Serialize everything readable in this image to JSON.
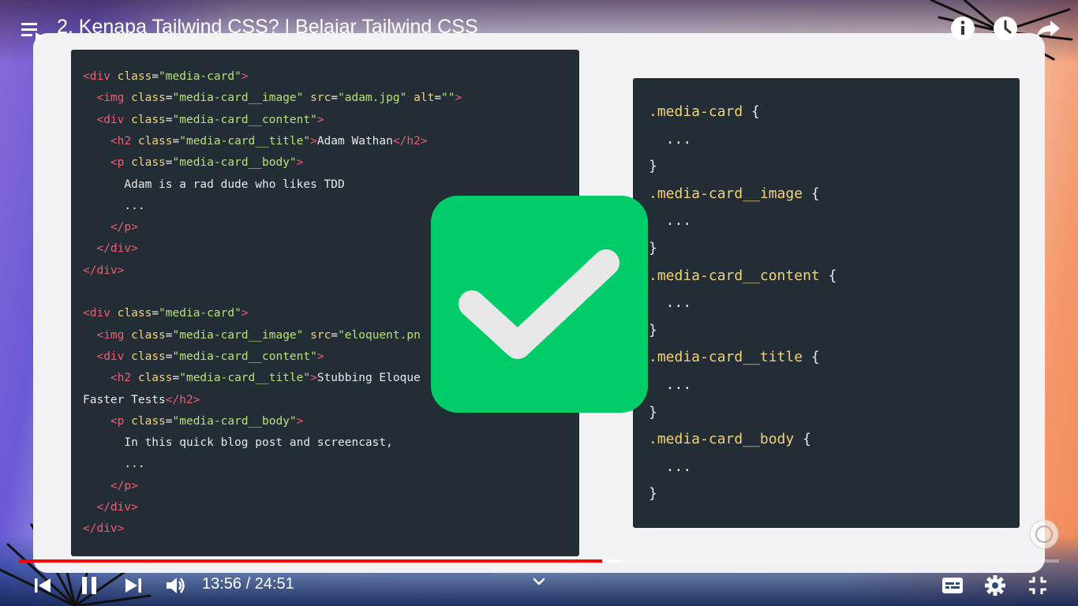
{
  "video": {
    "title": "2. Kenapa Tailwind CSS? | Belajar Tailwind CSS",
    "current_time": "13:56",
    "duration": "24:51",
    "time_display": "13:56 / 24:51",
    "progress": 0.561,
    "buffered": 0.578
  },
  "html_code": [
    [
      [
        "t",
        "<div "
      ],
      [
        "a",
        "class"
      ],
      [
        "p",
        "="
      ],
      [
        "v",
        "\"media-card\""
      ],
      [
        "t",
        ">"
      ]
    ],
    [
      [
        "p",
        "  "
      ],
      [
        "t",
        "<img "
      ],
      [
        "a",
        "class"
      ],
      [
        "p",
        "="
      ],
      [
        "v",
        "\"media-card__image\""
      ],
      [
        "p",
        " "
      ],
      [
        "a",
        "src"
      ],
      [
        "p",
        "="
      ],
      [
        "v",
        "\"adam.jpg\""
      ],
      [
        "p",
        " "
      ],
      [
        "a",
        "alt"
      ],
      [
        "p",
        "="
      ],
      [
        "v",
        "\"\""
      ],
      [
        "t",
        ">"
      ]
    ],
    [
      [
        "p",
        "  "
      ],
      [
        "t",
        "<div "
      ],
      [
        "a",
        "class"
      ],
      [
        "p",
        "="
      ],
      [
        "v",
        "\"media-card__content\""
      ],
      [
        "t",
        ">"
      ]
    ],
    [
      [
        "p",
        "    "
      ],
      [
        "t",
        "<h2 "
      ],
      [
        "a",
        "class"
      ],
      [
        "p",
        "="
      ],
      [
        "v",
        "\"media-card__title\""
      ],
      [
        "t",
        ">"
      ],
      [
        "p",
        "Adam Wathan"
      ],
      [
        "t",
        "</h2>"
      ]
    ],
    [
      [
        "p",
        "    "
      ],
      [
        "t",
        "<p "
      ],
      [
        "a",
        "class"
      ],
      [
        "p",
        "="
      ],
      [
        "v",
        "\"media-card__body\""
      ],
      [
        "t",
        ">"
      ]
    ],
    [
      [
        "p",
        "      Adam is a rad dude who likes TDD"
      ]
    ],
    [
      [
        "p",
        "      ..."
      ]
    ],
    [
      [
        "p",
        "    "
      ],
      [
        "t",
        "</p>"
      ]
    ],
    [
      [
        "p",
        "  "
      ],
      [
        "t",
        "</div>"
      ]
    ],
    [
      [
        "t",
        "</div>"
      ]
    ],
    [],
    [
      [
        "t",
        "<div "
      ],
      [
        "a",
        "class"
      ],
      [
        "p",
        "="
      ],
      [
        "v",
        "\"media-card\""
      ],
      [
        "t",
        ">"
      ]
    ],
    [
      [
        "p",
        "  "
      ],
      [
        "t",
        "<img "
      ],
      [
        "a",
        "class"
      ],
      [
        "p",
        "="
      ],
      [
        "v",
        "\"media-card__image\""
      ],
      [
        "p",
        " "
      ],
      [
        "a",
        "src"
      ],
      [
        "p",
        "="
      ],
      [
        "v",
        "\"eloquent.pn"
      ]
    ],
    [
      [
        "p",
        "  "
      ],
      [
        "t",
        "<div "
      ],
      [
        "a",
        "class"
      ],
      [
        "p",
        "="
      ],
      [
        "v",
        "\"media-card__content\""
      ],
      [
        "t",
        ">"
      ]
    ],
    [
      [
        "p",
        "    "
      ],
      [
        "t",
        "<h2 "
      ],
      [
        "a",
        "class"
      ],
      [
        "p",
        "="
      ],
      [
        "v",
        "\"media-card__title\""
      ],
      [
        "t",
        ">"
      ],
      [
        "p",
        "Stubbing Eloque"
      ]
    ],
    [
      [
        "p",
        "Faster Tests"
      ],
      [
        "t",
        "</h2>"
      ]
    ],
    [
      [
        "p",
        "    "
      ],
      [
        "t",
        "<p "
      ],
      [
        "a",
        "class"
      ],
      [
        "p",
        "="
      ],
      [
        "v",
        "\"media-card__body\""
      ],
      [
        "t",
        ">"
      ]
    ],
    [
      [
        "p",
        "      In this quick blog post and screencast,"
      ]
    ],
    [
      [
        "p",
        "      ..."
      ]
    ],
    [
      [
        "p",
        "    "
      ],
      [
        "t",
        "</p>"
      ]
    ],
    [
      [
        "p",
        "  "
      ],
      [
        "t",
        "</div>"
      ]
    ],
    [
      [
        "t",
        "</div>"
      ]
    ]
  ],
  "css_code": [
    [
      [
        "sel",
        ".media-card"
      ],
      [
        "p",
        " {"
      ]
    ],
    [
      [
        "p",
        "  ..."
      ]
    ],
    [
      [
        "p",
        "}"
      ]
    ],
    [
      [
        "sel",
        ".media-card__image"
      ],
      [
        "p",
        " {"
      ]
    ],
    [
      [
        "p",
        "  ..."
      ]
    ],
    [
      [
        "p",
        "}"
      ]
    ],
    [
      [
        "sel",
        ".media-card__content"
      ],
      [
        "p",
        " {"
      ]
    ],
    [
      [
        "p",
        "  ..."
      ]
    ],
    [
      [
        "p",
        "}"
      ]
    ],
    [
      [
        "sel",
        ".media-card__title"
      ],
      [
        "p",
        " {"
      ]
    ],
    [
      [
        "p",
        "  ..."
      ]
    ],
    [
      [
        "p",
        "}"
      ]
    ],
    [
      [
        "sel",
        ".media-card__body"
      ],
      [
        "p",
        " {"
      ]
    ],
    [
      [
        "p",
        "  ..."
      ]
    ],
    [
      [
        "p",
        "}"
      ]
    ]
  ],
  "icons": {
    "playlist": "playlist-icon",
    "info": "info-icon",
    "watch_later": "clock-icon",
    "share": "share-icon",
    "prev": "previous-icon",
    "pause": "pause-icon",
    "next": "next-icon",
    "volume": "volume-icon",
    "chapters": "chevron-down-icon",
    "captions": "captions-icon",
    "settings": "gear-icon",
    "exit_fullscreen": "exit-fullscreen-icon",
    "checkmark": "checkmark-icon"
  },
  "colors": {
    "progress": "#ff0000",
    "check_bg": "#00cd6a",
    "code_bg": "#232d36",
    "tag": "#f25b72",
    "attr": "#f1d27a",
    "value": "#b8e07a"
  }
}
